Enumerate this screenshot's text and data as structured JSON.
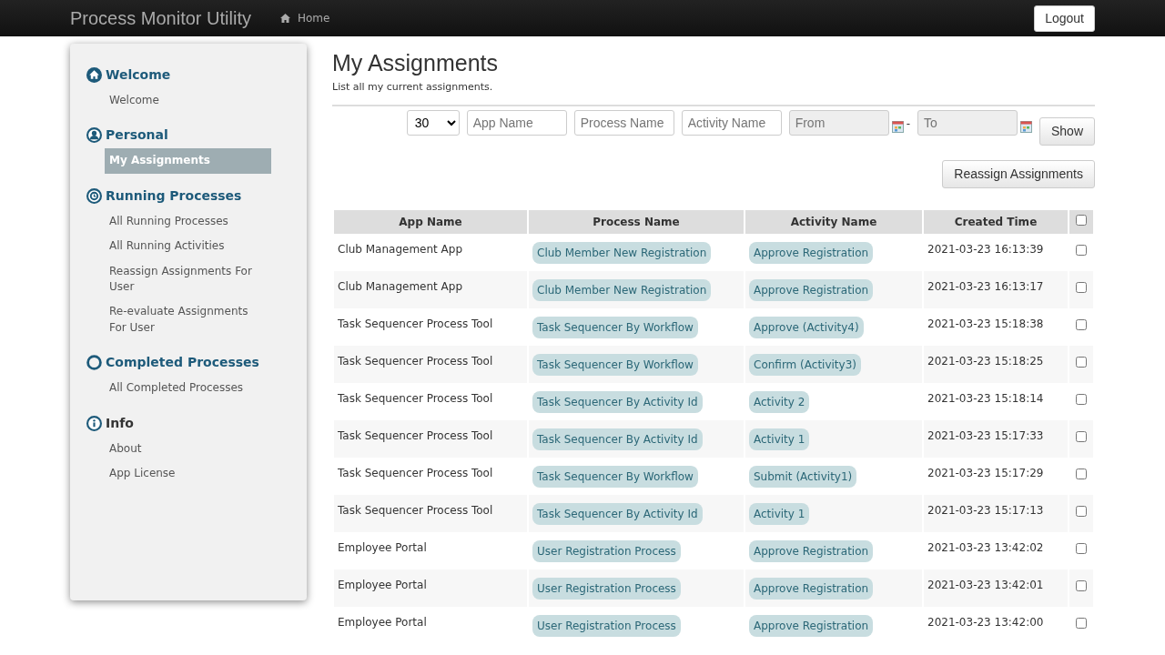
{
  "navbar": {
    "brand": "Process Monitor Utility",
    "home": "Home",
    "logout": "Logout"
  },
  "sidebar": {
    "sections": [
      {
        "title": "Welcome",
        "kind": "home",
        "items": [
          {
            "label": "Welcome",
            "selected": false
          }
        ]
      },
      {
        "title": "Personal",
        "kind": "person",
        "items": [
          {
            "label": "My Assignments",
            "selected": true
          }
        ]
      },
      {
        "title": "Running Processes",
        "kind": "clock",
        "items": [
          {
            "label": "All Running Processes",
            "selected": false
          },
          {
            "label": "All Running Activities",
            "selected": false
          },
          {
            "label": "Reassign Assignments For User",
            "selected": false
          },
          {
            "label": "Re-evaluate Assignments For User",
            "selected": false
          }
        ]
      },
      {
        "title": "Completed Processes",
        "kind": "ring",
        "items": [
          {
            "label": "All Completed Processes",
            "selected": false
          }
        ]
      },
      {
        "title": "Info",
        "kind": "info",
        "items": [
          {
            "label": "About",
            "selected": false
          },
          {
            "label": "App License",
            "selected": false
          }
        ]
      }
    ]
  },
  "page": {
    "title": "My Assignments",
    "subtitle": "List all my current assignments."
  },
  "filters": {
    "page_size": "30",
    "app_placeholder": "App Name",
    "process_placeholder": "Process Name",
    "activity_placeholder": "Activity Name",
    "from_placeholder": "From",
    "separator": "-",
    "to_placeholder": "To",
    "show": "Show",
    "reassign": "Reassign Assignments"
  },
  "table": {
    "columns": [
      "App Name",
      "Process Name",
      "Activity Name",
      "Created Time"
    ],
    "select_all_checked": false,
    "rows": [
      {
        "app": "Club Management App",
        "process": "Club Member New Registration",
        "activity": "Approve Registration",
        "created": "2021-03-23 16:13:39",
        "checked": false
      },
      {
        "app": "Club Management App",
        "process": "Club Member New Registration",
        "activity": "Approve Registration",
        "created": "2021-03-23 16:13:17",
        "checked": false
      },
      {
        "app": "Task Sequencer Process Tool",
        "process": "Task Sequencer By Workflow",
        "activity": "Approve (Activity4)",
        "created": "2021-03-23 15:18:38",
        "checked": false
      },
      {
        "app": "Task Sequencer Process Tool",
        "process": "Task Sequencer By Workflow",
        "activity": "Confirm (Activity3)",
        "created": "2021-03-23 15:18:25",
        "checked": false
      },
      {
        "app": "Task Sequencer Process Tool",
        "process": "Task Sequencer By Activity Id",
        "activity": "Activity 2",
        "created": "2021-03-23 15:18:14",
        "checked": false
      },
      {
        "app": "Task Sequencer Process Tool",
        "process": "Task Sequencer By Activity Id",
        "activity": "Activity 1",
        "created": "2021-03-23 15:17:33",
        "checked": false
      },
      {
        "app": "Task Sequencer Process Tool",
        "process": "Task Sequencer By Workflow",
        "activity": "Submit (Activity1)",
        "created": "2021-03-23 15:17:29",
        "checked": false
      },
      {
        "app": "Task Sequencer Process Tool",
        "process": "Task Sequencer By Activity Id",
        "activity": "Activity 1",
        "created": "2021-03-23 15:17:13",
        "checked": false
      },
      {
        "app": "Employee Portal",
        "process": "User Registration Process",
        "activity": "Approve Registration",
        "created": "2021-03-23 13:42:02",
        "checked": false
      },
      {
        "app": "Employee Portal",
        "process": "User Registration Process",
        "activity": "Approve Registration",
        "created": "2021-03-23 13:42:01",
        "checked": false
      },
      {
        "app": "Employee Portal",
        "process": "User Registration Process",
        "activity": "Approve Registration",
        "created": "2021-03-23 13:42:00",
        "checked": false
      }
    ]
  }
}
